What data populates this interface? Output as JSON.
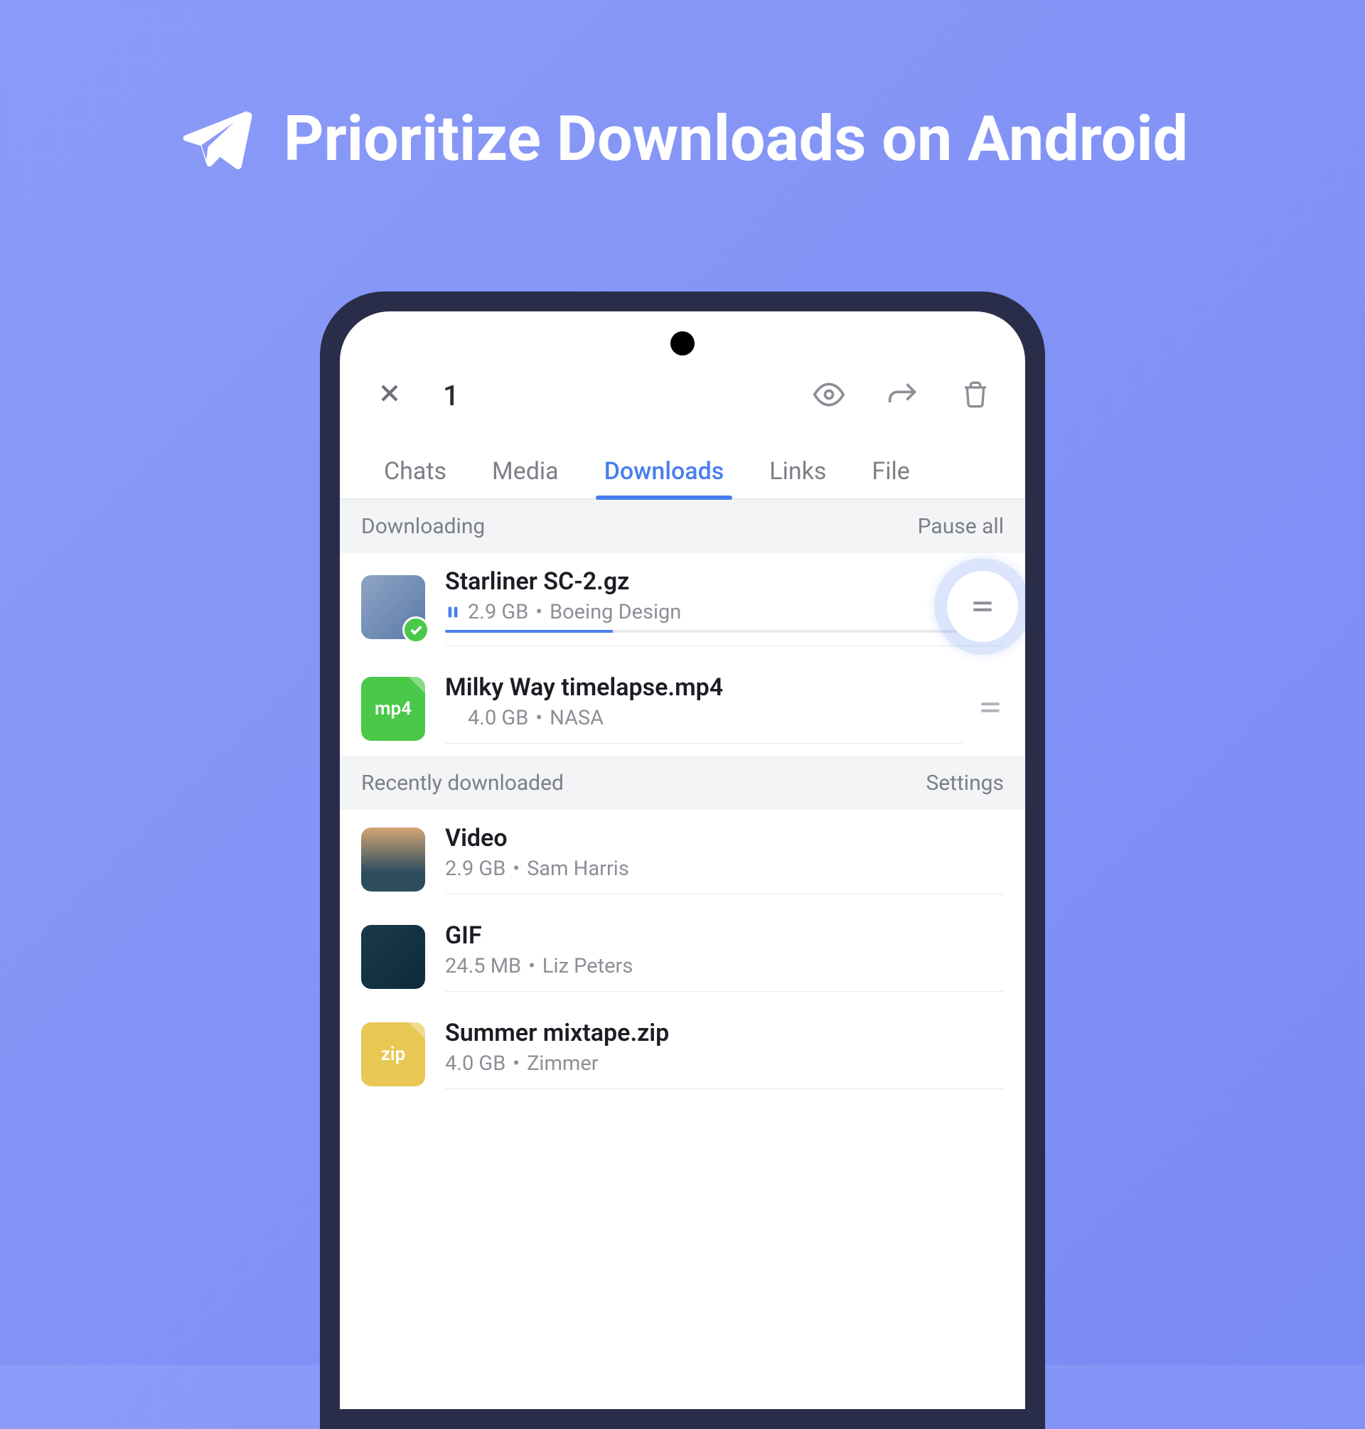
{
  "banner": {
    "title": "Prioritize Downloads on Android"
  },
  "toolbar": {
    "selected_count": "1"
  },
  "tabs": [
    {
      "label": "Chats",
      "active": false
    },
    {
      "label": "Media",
      "active": false
    },
    {
      "label": "Downloads",
      "active": true
    },
    {
      "label": "Links",
      "active": false
    },
    {
      "label": "File",
      "active": false
    }
  ],
  "sections": {
    "downloading": {
      "title": "Downloading",
      "action": "Pause all",
      "items": [
        {
          "title": "Starliner SC-2.gz",
          "size": "2.9 GB",
          "source": "Boeing Design",
          "status": "paused",
          "selected": true,
          "progress": 30
        },
        {
          "title": "Milky Way timelapse.mp4",
          "size": "4.0 GB",
          "source": "NASA",
          "status": "queued",
          "ext": "mp4"
        }
      ]
    },
    "recent": {
      "title": "Recently downloaded",
      "action": "Settings",
      "items": [
        {
          "title": "Video",
          "size": "2.9 GB",
          "source": "Sam Harris"
        },
        {
          "title": "GIF",
          "size": "24.5 MB",
          "source": "Liz Peters"
        },
        {
          "title": "Summer mixtape.zip",
          "size": "4.0 GB",
          "source": "Zimmer",
          "ext": "zip"
        }
      ]
    }
  }
}
